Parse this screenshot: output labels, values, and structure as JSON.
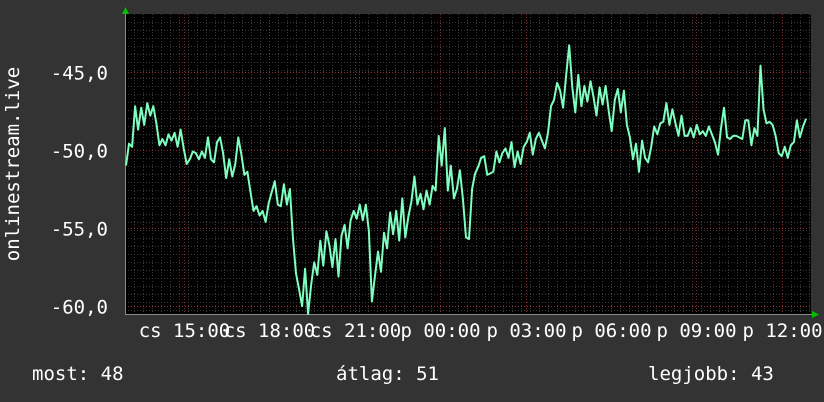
{
  "chart_data": {
    "type": "line",
    "ylabel": "onlinestream.live",
    "yticks": [
      "-45,0",
      "-50,0",
      "-55,0",
      "-60,0"
    ],
    "ytick_values": [
      -45,
      -50,
      -55,
      -60
    ],
    "ylim": [
      -60.5,
      -41.3
    ],
    "xticks": [
      "cs 15:00",
      "cs 18:00",
      "cs 21:00",
      "p 00:00",
      "p 03:00",
      "p 06:00",
      "p 09:00",
      "p 12:00"
    ],
    "grid": true,
    "series": [
      {
        "color": "#7fffbf",
        "values": [
          -51,
          -49.6,
          -49.8,
          -47.2,
          -48.7,
          -47.3,
          -48.4,
          -47,
          -47.8,
          -47.2,
          -48.3,
          -49.7,
          -49.3,
          -49.7,
          -49,
          -49.4,
          -48.9,
          -49.8,
          -48.7,
          -49.9,
          -50.9,
          -50.6,
          -50.1,
          -50.2,
          -50.6,
          -50.1,
          -50.5,
          -49.2,
          -50.6,
          -50.8,
          -49.5,
          -49.2,
          -50.2,
          -51.8,
          -50.6,
          -51.7,
          -50.9,
          -49.2,
          -50.3,
          -51.6,
          -51.4,
          -52.7,
          -53.9,
          -53.6,
          -54.2,
          -53.9,
          -54.6,
          -53.4,
          -52.7,
          -52,
          -53.5,
          -53.6,
          -52.2,
          -53.5,
          -52.5,
          -55.7,
          -57.9,
          -58.9,
          -60,
          -57.6,
          -60.5,
          -58.6,
          -57.2,
          -58,
          -55.8,
          -57.4,
          -55.2,
          -56.1,
          -57.5,
          -55.7,
          -58.1,
          -55.5,
          -54.8,
          -56.3,
          -54.5,
          -53.9,
          -54.4,
          -53.5,
          -54.5,
          -53.5,
          -55.2,
          -59.7,
          -58.1,
          -56.5,
          -57.8,
          -55.3,
          -56.3,
          -54,
          -55.4,
          -53.9,
          -55.8,
          -53.1,
          -55.6,
          -54.3,
          -53.3,
          -51.7,
          -53.5,
          -52.8,
          -53.8,
          -52.6,
          -53.5,
          -52.3,
          -52.6,
          -49.1,
          -51,
          -48.6,
          -52.6,
          -51,
          -53.1,
          -52.5,
          -51.3,
          -53.2,
          -55.6,
          -55.7,
          -52.5,
          -51.5,
          -51.1,
          -50.5,
          -50.4,
          -51.6,
          -51.5,
          -51.4,
          -50.1,
          -50.8,
          -50.2,
          -49.9,
          -50.5,
          -49.5,
          -51.1,
          -50.1,
          -50.9,
          -49.8,
          -49.5,
          -48.9,
          -50.3,
          -49.3,
          -48.9,
          -49.4,
          -49.9,
          -48.9,
          -47.2,
          -46.8,
          -45.7,
          -46.2,
          -47.3,
          -45.2,
          -43.3,
          -46,
          -47.6,
          -45.2,
          -47.2,
          -45.9,
          -46.9,
          -45.6,
          -46.6,
          -47.8,
          -46,
          -47.1,
          -45.9,
          -47.5,
          -48.8,
          -46.8,
          -46.1,
          -47.6,
          -46.2,
          -48.4,
          -49.2,
          -50.6,
          -49.6,
          -51.4,
          -49.4,
          -50.5,
          -50.8,
          -49.8,
          -48.5,
          -49,
          -48.3,
          -48.2,
          -47,
          -48.4,
          -47.4,
          -48.3,
          -49.1,
          -47.8,
          -49.1,
          -49.1,
          -48.6,
          -49.2,
          -48.4,
          -49,
          -48.8,
          -49.1,
          -48.5,
          -49,
          -49.5,
          -50.3,
          -48.6,
          -47.3,
          -49.2,
          -49.3,
          -49.1,
          -49.1,
          -49.2,
          -49.3,
          -48.1,
          -48.1,
          -49.7,
          -48.6,
          -49.1,
          -44.6,
          -47.4,
          -48.3,
          -48.2,
          -48.4,
          -49.1,
          -50.2,
          -50.4,
          -49.8,
          -50.5,
          -49.7,
          -49.5,
          -48.1,
          -49.2,
          -48.5,
          -48
        ]
      }
    ]
  },
  "stats": {
    "now_label": "most:",
    "now_value": "48",
    "avg_label": "átlag:",
    "avg_value": "51",
    "best_label": "legjobb:",
    "best_value": "43"
  }
}
